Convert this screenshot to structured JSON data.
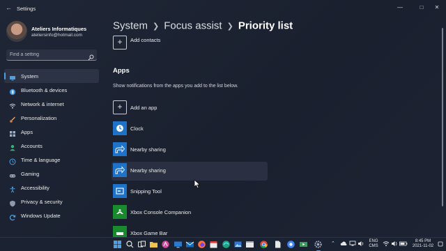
{
  "window": {
    "title": "Settings",
    "back_icon": "back-arrow-icon",
    "minimize_icon": "minimize-icon",
    "maximize_icon": "maximize-icon",
    "close_icon": "close-icon"
  },
  "profile": {
    "name": "Ateliers Informatiques",
    "email": "ateliersinfo@hotmail.com"
  },
  "search": {
    "placeholder": "Find a setting",
    "value": ""
  },
  "nav": {
    "items": [
      {
        "label": "System",
        "icon": "monitor-icon",
        "active": true
      },
      {
        "label": "Bluetooth & devices",
        "icon": "bluetooth-icon"
      },
      {
        "label": "Network & internet",
        "icon": "wifi-icon"
      },
      {
        "label": "Personalization",
        "icon": "brush-icon"
      },
      {
        "label": "Apps",
        "icon": "apps-grid-icon"
      },
      {
        "label": "Accounts",
        "icon": "person-icon"
      },
      {
        "label": "Time & language",
        "icon": "globe-clock-icon"
      },
      {
        "label": "Gaming",
        "icon": "gamepad-icon"
      },
      {
        "label": "Accessibility",
        "icon": "accessibility-icon"
      },
      {
        "label": "Privacy & security",
        "icon": "shield-icon"
      },
      {
        "label": "Windows Update",
        "icon": "update-icon"
      }
    ]
  },
  "breadcrumb": {
    "level1": "System",
    "level2": "Focus assist",
    "current": "Priority list"
  },
  "content": {
    "add_contacts": "Add contacts",
    "apps_heading": "Apps",
    "apps_description": "Show notifications from the apps you add to the list below.",
    "add_app": "Add an app",
    "apps": [
      {
        "label": "Clock",
        "icon": "clock-icon"
      },
      {
        "label": "Nearby sharing",
        "icon": "nearby-sharing-icon"
      },
      {
        "label": "Nearby sharing",
        "icon": "nearby-sharing-icon",
        "hover": true
      },
      {
        "label": "Snipping Tool",
        "icon": "snipping-tool-icon"
      },
      {
        "label": "Xbox Console Companion",
        "icon": "xbox-icon"
      },
      {
        "label": "Xbox Game Bar",
        "icon": "xbox-game-bar-icon"
      }
    ]
  },
  "taskbar": {
    "apps": [
      "windows-start-icon",
      "search-icon",
      "task-view-icon",
      "file-explorer-icon",
      "app-icon",
      "desktop-icon",
      "mail-icon",
      "firefox-icon",
      "calendar-icon",
      "edge-icon",
      "photos-icon",
      "terminal-icon",
      "chrome-icon",
      "settings-icon",
      "file-icon"
    ],
    "language_top": "ENG",
    "language_bottom": "CMS",
    "time": "8:45 PM",
    "date": "2021-11-02"
  },
  "colors": {
    "accent": "#4ca0e6",
    "background": "#1f2636",
    "hover": "#2a3041"
  }
}
